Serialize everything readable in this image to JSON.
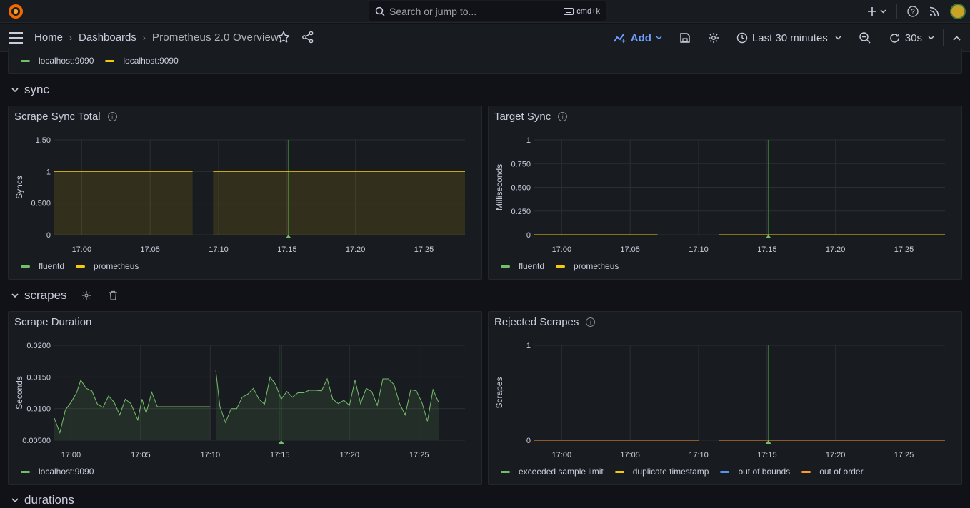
{
  "topbar": {
    "search_placeholder": "Search or jump to...",
    "search_shortcut": "cmd+k"
  },
  "navbar": {
    "breadcrumb": [
      "Home",
      "Dashboards",
      "Prometheus 2.0 Overview"
    ],
    "add_label": "Add",
    "time_range": "Last 30 minutes",
    "refresh_interval": "30s"
  },
  "top_panel_legend": [
    {
      "label": "localhost:9090",
      "color": "#73bf69"
    },
    {
      "label": "localhost:9090",
      "color": "#f2cc0c"
    }
  ],
  "rows": {
    "sync": "sync",
    "scrapes": "scrapes",
    "durations": "durations"
  },
  "panels": {
    "scrape_sync_total": {
      "title": "Scrape Sync Total",
      "legend": [
        {
          "label": "fluentd",
          "color": "#73bf69"
        },
        {
          "label": "prometheus",
          "color": "#f2cc0c"
        }
      ]
    },
    "target_sync": {
      "title": "Target Sync",
      "legend": [
        {
          "label": "fluentd",
          "color": "#73bf69"
        },
        {
          "label": "prometheus",
          "color": "#f2cc0c"
        }
      ]
    },
    "scrape_duration": {
      "title": "Scrape Duration",
      "legend": [
        {
          "label": "localhost:9090",
          "color": "#73bf69"
        }
      ]
    },
    "rejected_scrapes": {
      "title": "Rejected Scrapes",
      "legend": [
        {
          "label": "exceeded sample limit",
          "color": "#73bf69"
        },
        {
          "label": "duplicate timestamp",
          "color": "#f2cc0c"
        },
        {
          "label": "out of bounds",
          "color": "#5794f2"
        },
        {
          "label": "out of order",
          "color": "#ff9830"
        }
      ]
    }
  },
  "chart_data": [
    {
      "type": "area",
      "title": "Scrape Sync Total",
      "ylabel": "Syncs",
      "x_ticks": [
        "17:00",
        "17:05",
        "17:10",
        "17:15",
        "17:20",
        "17:25"
      ],
      "y_ticks": [
        "0",
        "0.500",
        "1",
        "1.50"
      ],
      "ylim": [
        0,
        1.5
      ],
      "xlim_minutes": [
        -2,
        28
      ],
      "series": [
        {
          "name": "prometheus",
          "color": "#f2cc0c",
          "segments": [
            [
              [
                -2,
                1
              ],
              [
                8.1,
                1
              ]
            ],
            [
              [
                9.6,
                1
              ],
              [
                28,
                1
              ]
            ]
          ]
        }
      ]
    },
    {
      "type": "line",
      "title": "Target Sync",
      "ylabel": "Milliseconds",
      "x_ticks": [
        "17:00",
        "17:05",
        "17:10",
        "17:15",
        "17:20",
        "17:25"
      ],
      "y_ticks": [
        "0",
        "0.250",
        "0.500",
        "0.750",
        "1"
      ],
      "ylim": [
        0,
        1
      ],
      "xlim_minutes": [
        -2,
        28
      ],
      "series": [
        {
          "name": "prometheus",
          "color": "#f2cc0c",
          "segments": [
            [
              [
                -2,
                0
              ],
              [
                7.0,
                0
              ]
            ],
            [
              [
                11.5,
                0
              ],
              [
                28,
                0
              ]
            ]
          ]
        }
      ]
    },
    {
      "type": "area",
      "title": "Scrape Duration",
      "ylabel": "Seconds",
      "x_ticks": [
        "17:00",
        "17:05",
        "17:10",
        "17:15",
        "17:20",
        "17:25"
      ],
      "y_ticks": [
        "0.00500",
        "0.0100",
        "0.0150",
        "0.0200"
      ],
      "ylim": [
        0.005,
        0.02
      ],
      "xlim_minutes": [
        -1.2,
        28.3
      ],
      "series": [
        {
          "name": "localhost:9090",
          "color": "#73bf69",
          "segments": [
            [
              [
                -1.2,
                0.0085
              ],
              [
                -0.8,
                0.0062
              ],
              [
                -0.4,
                0.0098
              ],
              [
                0,
                0.011
              ],
              [
                0.4,
                0.0125
              ],
              [
                0.7,
                0.0145
              ],
              [
                1.1,
                0.0132
              ],
              [
                1.5,
                0.0128
              ],
              [
                1.9,
                0.0107
              ],
              [
                2.3,
                0.0102
              ],
              [
                2.7,
                0.012
              ],
              [
                3.1,
                0.011
              ],
              [
                3.5,
                0.009
              ],
              [
                3.9,
                0.0115
              ],
              [
                4.3,
                0.0108
              ],
              [
                4.8,
                0.0082
              ],
              [
                5.1,
                0.0115
              ],
              [
                5.4,
                0.0093
              ],
              [
                5.8,
                0.0126
              ],
              [
                6.2,
                0.0103
              ],
              [
                7.0,
                0.0103
              ],
              [
                8.0,
                0.0103
              ],
              [
                9.0,
                0.0103
              ],
              [
                10.0,
                0.0103
              ]
            ],
            [
              [
                10.4,
                0.016
              ],
              [
                10.7,
                0.0103
              ],
              [
                11.1,
                0.0078
              ],
              [
                11.5,
                0.01
              ],
              [
                11.9,
                0.01
              ],
              [
                12.3,
                0.0118
              ],
              [
                12.7,
                0.0123
              ],
              [
                13.1,
                0.0132
              ],
              [
                13.5,
                0.0115
              ],
              [
                13.9,
                0.0107
              ],
              [
                14.3,
                0.015
              ],
              [
                14.7,
                0.0138
              ],
              [
                15.1,
                0.0115
              ],
              [
                15.5,
                0.0127
              ],
              [
                15.9,
                0.0118
              ],
              [
                16.3,
                0.0125
              ],
              [
                16.7,
                0.0125
              ],
              [
                17.1,
                0.0129
              ],
              [
                17.6,
                0.0129
              ],
              [
                18.0,
                0.0128
              ],
              [
                18.4,
                0.0147
              ],
              [
                18.8,
                0.0115
              ],
              [
                19.2,
                0.0108
              ],
              [
                19.6,
                0.0113
              ],
              [
                20.0,
                0.0105
              ],
              [
                20.4,
                0.0145
              ],
              [
                20.8,
                0.0108
              ],
              [
                21.2,
                0.0132
              ],
              [
                21.6,
                0.0127
              ],
              [
                22.0,
                0.0105
              ],
              [
                22.4,
                0.0147
              ],
              [
                22.8,
                0.0147
              ],
              [
                23.2,
                0.0138
              ],
              [
                23.6,
                0.0108
              ],
              [
                24.0,
                0.009
              ],
              [
                24.4,
                0.013
              ],
              [
                24.8,
                0.0128
              ],
              [
                25.2,
                0.011
              ],
              [
                25.6,
                0.008
              ],
              [
                26.0,
                0.013
              ],
              [
                26.4,
                0.011
              ]
            ]
          ]
        }
      ]
    },
    {
      "type": "line",
      "title": "Rejected Scrapes",
      "ylabel": "Scrapes",
      "x_ticks": [
        "17:00",
        "17:05",
        "17:10",
        "17:15",
        "17:20",
        "17:25"
      ],
      "y_ticks": [
        "0",
        "1"
      ],
      "ylim": [
        0,
        1
      ],
      "xlim_minutes": [
        -2,
        28
      ],
      "series": [
        {
          "name": "out of order",
          "color": "#ff9830",
          "segments": [
            [
              [
                -2,
                0
              ],
              [
                10.0,
                0
              ]
            ],
            [
              [
                11.5,
                0
              ],
              [
                28,
                0
              ]
            ]
          ]
        }
      ]
    }
  ]
}
